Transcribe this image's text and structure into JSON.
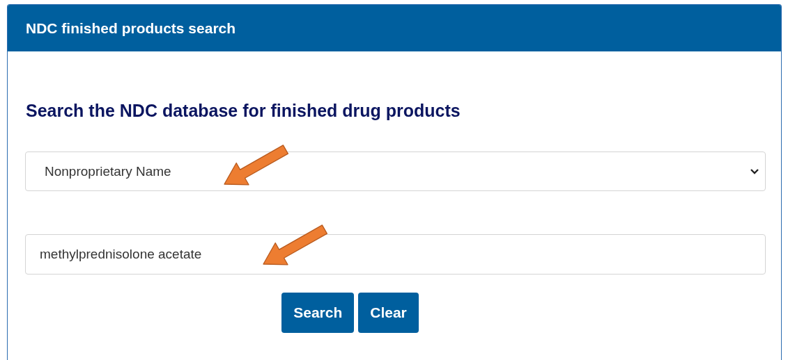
{
  "panel": {
    "title": "NDC finished products search"
  },
  "heading": "Search the NDC database for finished drug products",
  "search_type": {
    "value": "Nonproprietary Name"
  },
  "search_field": {
    "value": "methylprednisolone acetate"
  },
  "buttons": [
    "Search",
    "Clear"
  ],
  "callout_arrows": [
    {
      "color": "#ed7d31"
    },
    {
      "color": "#ed7d31"
    }
  ]
}
